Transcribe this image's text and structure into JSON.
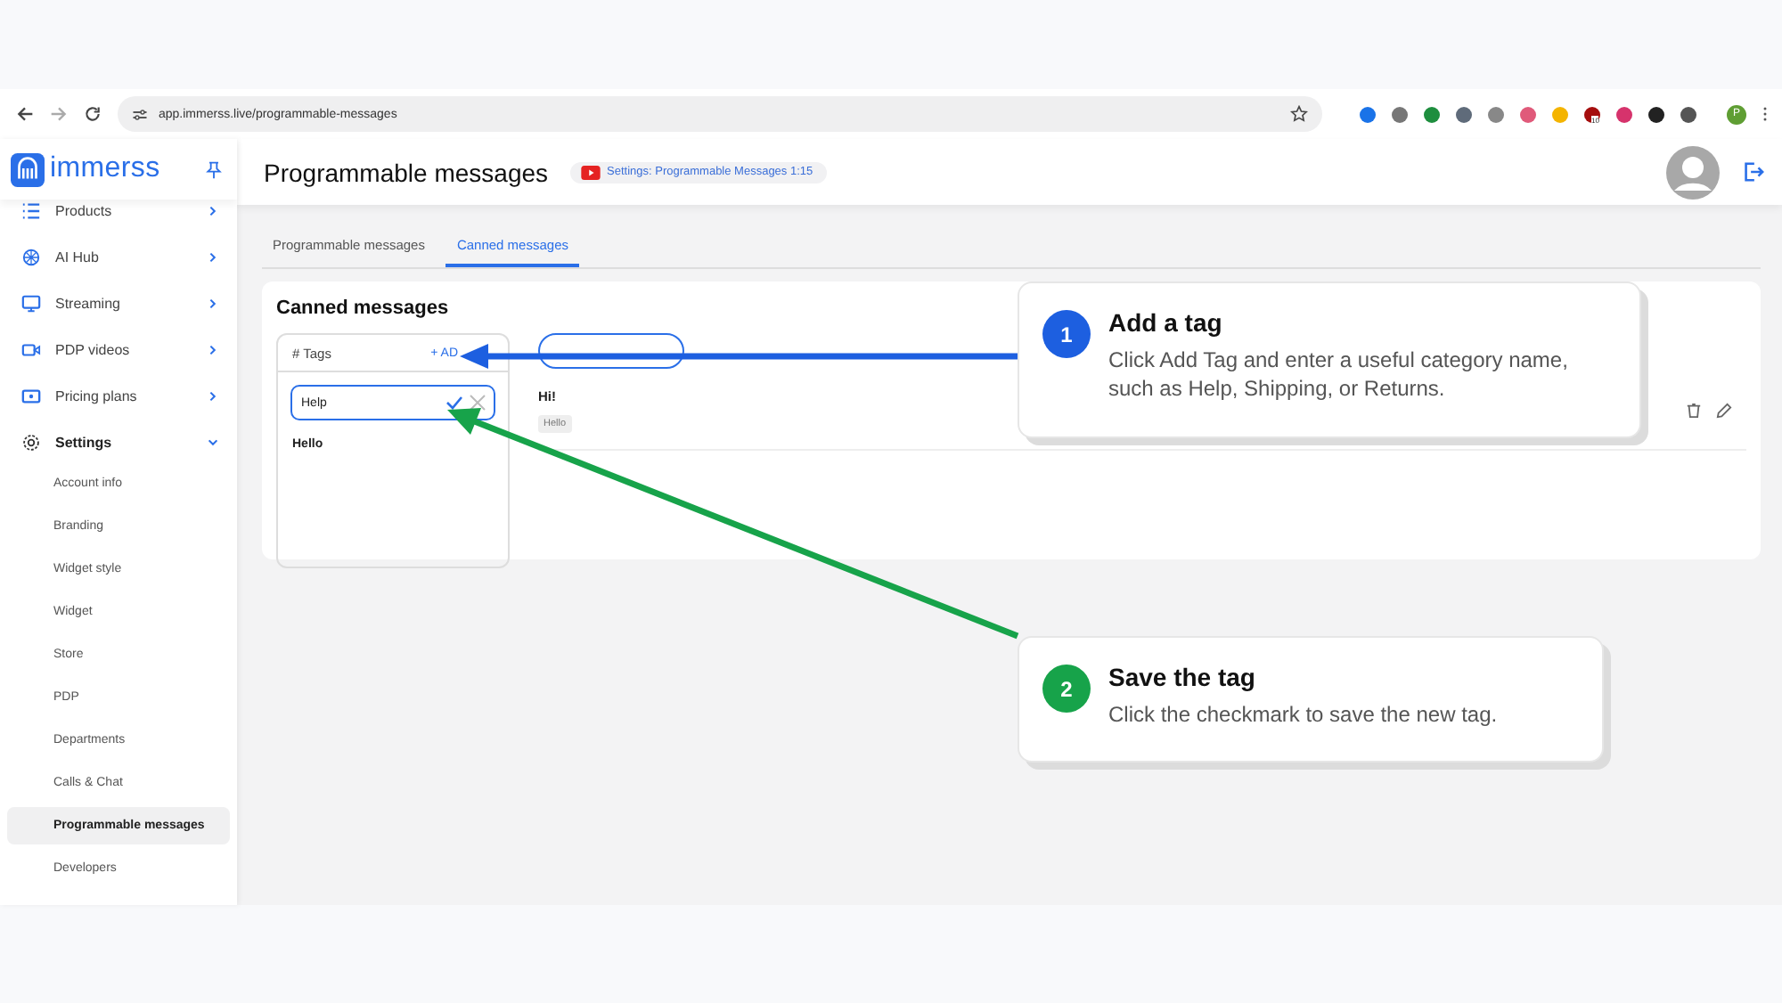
{
  "browser": {
    "url": "app.immerss.live/programmable-messages",
    "extension_badge": "10",
    "profile_initial": "P"
  },
  "sidebar": {
    "logo": "immerss",
    "items": [
      {
        "label": "Products",
        "expanded": false
      },
      {
        "label": "AI Hub",
        "expanded": false
      },
      {
        "label": "Streaming",
        "expanded": false
      },
      {
        "label": "PDP videos",
        "expanded": false
      },
      {
        "label": "Pricing plans",
        "expanded": false
      },
      {
        "label": "Settings",
        "expanded": true,
        "children": [
          {
            "label": "Account info",
            "selected": false
          },
          {
            "label": "Branding",
            "selected": false
          },
          {
            "label": "Widget style",
            "selected": false
          },
          {
            "label": "Widget",
            "selected": false
          },
          {
            "label": "Store",
            "selected": false
          },
          {
            "label": "PDP",
            "selected": false
          },
          {
            "label": "Departments",
            "selected": false
          },
          {
            "label": "Calls & Chat",
            "selected": false
          },
          {
            "label": "Programmable messages",
            "selected": true
          },
          {
            "label": "Developers",
            "selected": false
          }
        ]
      }
    ]
  },
  "header": {
    "title": "Programmable messages",
    "video_badge": "Settings: Programmable Messages 1:15"
  },
  "tabs": [
    {
      "label": "Programmable messages",
      "selected": false
    },
    {
      "label": "Canned messages",
      "selected": true
    }
  ],
  "card": {
    "title": "Canned messages",
    "tags_panel": {
      "heading": "# Tags",
      "add_label": "+ AD",
      "editing_tag": {
        "value": "Help"
      },
      "tags": [
        "Hello"
      ]
    },
    "messages": [
      {
        "text": "Hi!",
        "tag": "Hello"
      }
    ]
  },
  "callouts": [
    {
      "number": "1",
      "title": "Add a tag",
      "body": "Click Add Tag and enter a useful category name, such as Help, Shipping, or Returns.",
      "color": "#1d5fe0"
    },
    {
      "number": "2",
      "title": "Save the tag",
      "body": "Click the checkmark to save the new tag.",
      "color": "#17a34a"
    }
  ]
}
